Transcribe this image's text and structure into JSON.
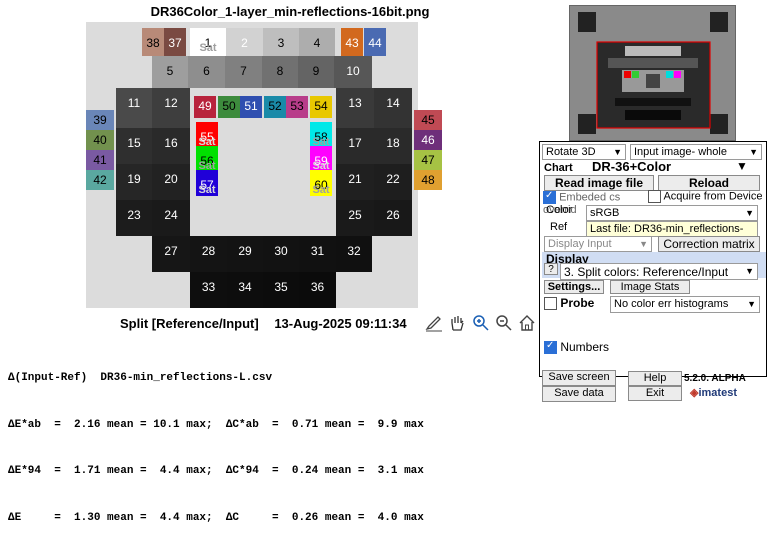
{
  "chart": {
    "title": "DR36Color_1-layer_min-reflections-16bit.png",
    "caption_mode": "Split [Reference/Input]",
    "caption_time": "13-Aug-2025 09:11:34",
    "sat_label": "Sat",
    "patches": [
      {
        "n": "38",
        "c": "#b88a78",
        "t": "#000"
      },
      {
        "n": "37",
        "c": "#7a4a42",
        "t": "#fff"
      },
      {
        "n": "1",
        "c": "#ffffff",
        "t": "#000",
        "sat": true
      },
      {
        "n": "2",
        "c": "#d2d2d2",
        "t": "#fff"
      },
      {
        "n": "3",
        "c": "#bebebe",
        "t": "#000"
      },
      {
        "n": "4",
        "c": "#adadad",
        "t": "#000"
      },
      {
        "n": "43",
        "c": "#d2691e",
        "t": "#fff"
      },
      {
        "n": "44",
        "c": "#4a6ab2",
        "t": "#fff"
      },
      {
        "n": "5",
        "c": "#9e9e9e",
        "t": "#000"
      },
      {
        "n": "6",
        "c": "#8e8e8e",
        "t": "#000"
      },
      {
        "n": "7",
        "c": "#808080",
        "t": "#000"
      },
      {
        "n": "8",
        "c": "#717171",
        "t": "#000"
      },
      {
        "n": "9",
        "c": "#646464",
        "t": "#000"
      },
      {
        "n": "10",
        "c": "#575757",
        "t": "#fff"
      },
      {
        "n": "39",
        "c": "#6a86b8",
        "t": "#000"
      },
      {
        "n": "40",
        "c": "#72914e",
        "t": "#000"
      },
      {
        "n": "41",
        "c": "#7a5aa2",
        "t": "#000"
      },
      {
        "n": "42",
        "c": "#5aa8a0",
        "t": "#000"
      },
      {
        "n": "11",
        "c": "#4a4a4a",
        "t": "#fff"
      },
      {
        "n": "12",
        "c": "#3e3e3e",
        "t": "#fff"
      },
      {
        "n": "49",
        "c": "#b8233c",
        "t": "#fff"
      },
      {
        "n": "50",
        "c": "#3d8b3d",
        "t": "#000"
      },
      {
        "n": "51",
        "c": "#2f4fb0",
        "t": "#fff"
      },
      {
        "n": "52",
        "c": "#1a8aa8",
        "t": "#000"
      },
      {
        "n": "53",
        "c": "#b83d8a",
        "t": "#000"
      },
      {
        "n": "54",
        "c": "#e8c800",
        "t": "#000"
      },
      {
        "n": "13",
        "c": "#3a3a3a",
        "t": "#fff"
      },
      {
        "n": "14",
        "c": "#333333",
        "t": "#fff"
      },
      {
        "n": "45",
        "c": "#c04a54",
        "t": "#000"
      },
      {
        "n": "46",
        "c": "#6e2f7a",
        "t": "#fff"
      },
      {
        "n": "47",
        "c": "#a6c244",
        "t": "#000"
      },
      {
        "n": "48",
        "c": "#e0a030",
        "t": "#000"
      },
      {
        "n": "15",
        "c": "#2f2f2f",
        "t": "#fff"
      },
      {
        "n": "16",
        "c": "#2a2a2a",
        "t": "#fff"
      },
      {
        "n": "55",
        "c": "#ff0000",
        "t": "#fff",
        "sat": true
      },
      {
        "n": "56",
        "c": "#00e000",
        "t": "#000",
        "sat": true
      },
      {
        "n": "57",
        "c": "#2000d8",
        "t": "#fff",
        "sat": true
      },
      {
        "n": "58",
        "c": "#00e8e8",
        "t": "#000",
        "sat": true
      },
      {
        "n": "59",
        "c": "#ff00ff",
        "t": "#fff",
        "sat": true
      },
      {
        "n": "60",
        "c": "#ffff00",
        "t": "#000",
        "sat": true
      },
      {
        "n": "17",
        "c": "#2a2a2a",
        "t": "#fff"
      },
      {
        "n": "18",
        "c": "#2a2a2a",
        "t": "#fff"
      },
      {
        "n": "19",
        "c": "#262626",
        "t": "#fff"
      },
      {
        "n": "20",
        "c": "#222222",
        "t": "#fff"
      },
      {
        "n": "21",
        "c": "#202020",
        "t": "#fff"
      },
      {
        "n": "22",
        "c": "#1e1e1e",
        "t": "#fff"
      },
      {
        "n": "23",
        "c": "#1c1c1c",
        "t": "#fff"
      },
      {
        "n": "24",
        "c": "#1a1a1a",
        "t": "#fff"
      },
      {
        "n": "25",
        "c": "#1a1a1a",
        "t": "#fff"
      },
      {
        "n": "26",
        "c": "#181818",
        "t": "#fff"
      },
      {
        "n": "27",
        "c": "#161616",
        "t": "#fff"
      },
      {
        "n": "28",
        "c": "#141414",
        "t": "#fff"
      },
      {
        "n": "29",
        "c": "#131313",
        "t": "#fff"
      },
      {
        "n": "30",
        "c": "#121212",
        "t": "#fff"
      },
      {
        "n": "31",
        "c": "#111111",
        "t": "#fff"
      },
      {
        "n": "32",
        "c": "#101010",
        "t": "#fff"
      },
      {
        "n": "33",
        "c": "#0e0e0e",
        "t": "#fff"
      },
      {
        "n": "34",
        "c": "#0d0d0d",
        "t": "#fff"
      },
      {
        "n": "35",
        "c": "#0c0c0c",
        "t": "#fff"
      },
      {
        "n": "36",
        "c": "#0b0b0b",
        "t": "#fff"
      }
    ]
  },
  "stats": {
    "line1": "Δ(Input-Ref)  DR36-min_reflections-L.csv",
    "line2": "ΔE*ab  =  2.16 mean = 10.1 max;  ΔC*ab  =  0.71 mean =  9.9 max",
    "line3": "ΔE*94  =  1.71 mean =  4.4 max;  ΔC*94  =  0.24 mean =  3.1 max",
    "line4": "ΔE     =  1.30 mean =  4.4 max;  ΔC     =  0.26 mean =  4.0 max"
  },
  "panel": {
    "rotate": "Rotate 3D",
    "input_image": "Input image- whole",
    "chart_label": "Chart",
    "chart_value": "DR-36+Color",
    "read_image": "Read image file",
    "reload": "Reload",
    "embedded_cs": "Embeded cs overrid",
    "acquire": "Acquire from Device",
    "color_space_label": "Color",
    "color_space": "sRGB",
    "ref_label": "Ref",
    "last_file": "Last file: DR36-min_reflections-",
    "display_input": "Display Input",
    "correction_matrix": "Correction matrix",
    "display_label": "Display",
    "help_q": "?",
    "split_colors": "3.  Split colors: Reference/Input",
    "settings": "Settings...",
    "image_stats": "Image Stats",
    "probe": "Probe",
    "histograms": "No color err histograms",
    "numbers": "Numbers",
    "save_screen": "Save screen",
    "help": "Help",
    "version": "5.2.0. ALPHA",
    "save_data": "Save data",
    "exit": "Exit",
    "brand": "imatest"
  }
}
